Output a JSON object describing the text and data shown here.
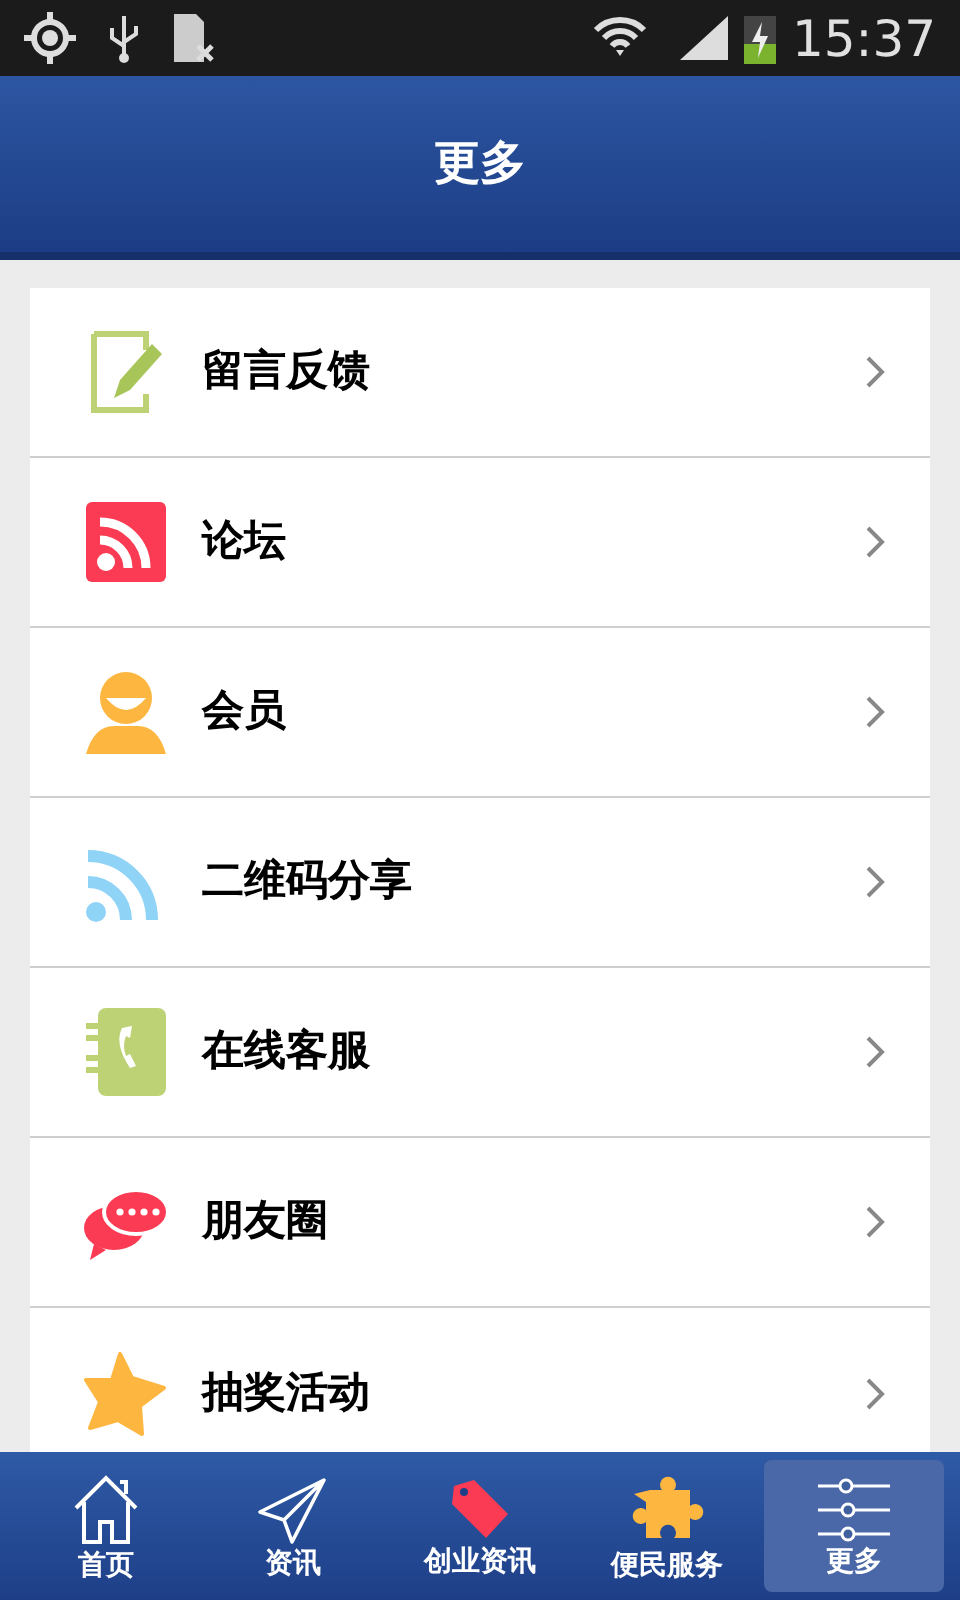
{
  "status_bar": {
    "time": "15:37"
  },
  "header": {
    "title": "更多"
  },
  "menu": [
    {
      "label": "留言反馈",
      "kind": "feedback"
    },
    {
      "label": "论坛",
      "kind": "forum"
    },
    {
      "label": "会员",
      "kind": "member"
    },
    {
      "label": "二维码分享",
      "kind": "share"
    },
    {
      "label": "在线客服",
      "kind": "service"
    },
    {
      "label": "朋友圈",
      "kind": "friends"
    },
    {
      "label": "抽奖活动",
      "kind": "lottery"
    }
  ],
  "tab_bar": [
    {
      "label": "首页",
      "kind": "home",
      "selected": false
    },
    {
      "label": "资讯",
      "kind": "news",
      "selected": false
    },
    {
      "label": "创业资讯",
      "kind": "tag",
      "selected": false
    },
    {
      "label": "便民服务",
      "kind": "puzzle",
      "selected": false
    },
    {
      "label": "更多",
      "kind": "more",
      "selected": true
    }
  ]
}
